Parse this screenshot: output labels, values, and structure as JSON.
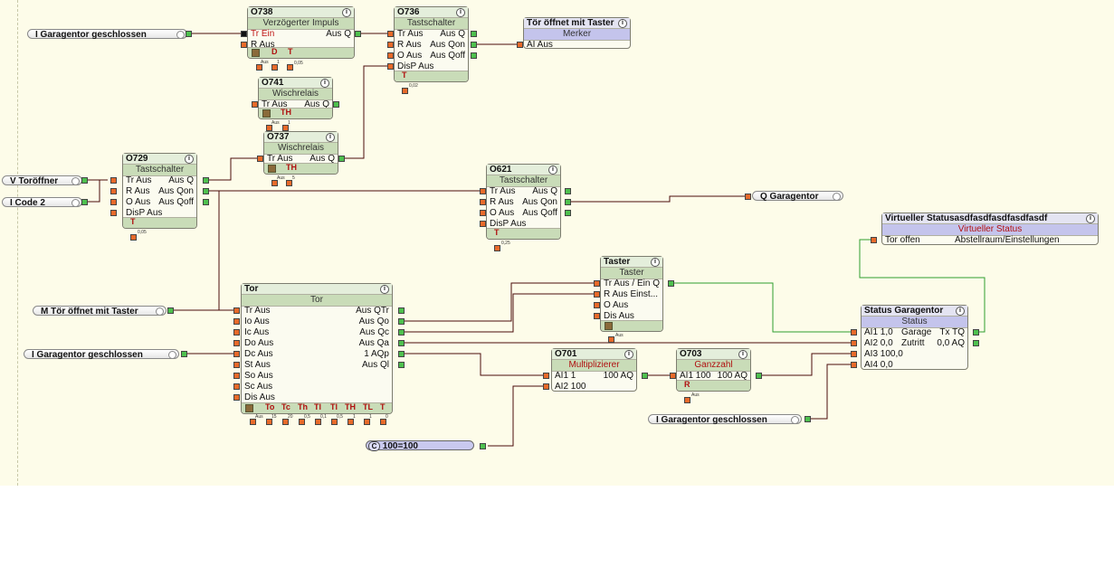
{
  "colors": {
    "wire_dark": "#4a0b0b",
    "wire_green": "#2f9e2f",
    "pin_input": "#e86a2a",
    "pin_output": "#4ec04e",
    "header_green": "#e4eedb",
    "header_purple": "#e4e4f2",
    "canvas_bg": "#fdfce9"
  },
  "inputs": {
    "garagentor1": "I   Garagentor geschlossen",
    "toroeffner": "V   Toröffner",
    "code2": "I   Code 2",
    "toer_taster": "M  Tör öffnet mit Taster",
    "garagentor2": "I   Garagentor geschlossen",
    "garagentor3": "I   Garagentor geschlossen",
    "const": "100=100",
    "const_badge": "C",
    "q_garagentor": "Q   Garagentor"
  },
  "blocks": {
    "o738": {
      "id": "O738",
      "type": "Verzögerter Impuls",
      "in1": "Tr Ein",
      "in2": "R Aus",
      "out1": "Aus Q",
      "p1": "D",
      "p2": "T",
      "t1": "Aus",
      "t2": "1",
      "t3": "0,05"
    },
    "o736": {
      "id": "O736",
      "type": "Tastschalter",
      "in1": "Tr Aus",
      "in2": "R Aus",
      "in3": "O Aus",
      "in4": "DisP Aus",
      "out1": "Aus Q",
      "out2": "Aus Qon",
      "out3": "Aus Qoff",
      "p1": "T",
      "t1": "0,02"
    },
    "merker": {
      "id": "Tör öffnet mit Taster",
      "type": "Merker",
      "in1": "AI Aus"
    },
    "o741": {
      "id": "O741",
      "type": "Wischrelais",
      "in1": "Tr Aus",
      "out1": "Aus Q",
      "p1": "TH",
      "t1": "Aus",
      "t2": "1"
    },
    "o737": {
      "id": "O737",
      "type": "Wischrelais",
      "in1": "Tr Aus",
      "out1": "Aus Q",
      "p1": "TH",
      "t1": "Aus",
      "t2": "5"
    },
    "o729": {
      "id": "O729",
      "type": "Tastschalter",
      "in1": "Tr Aus",
      "in2": "R Aus",
      "in3": "O Aus",
      "in4": "DisP Aus",
      "out1": "Aus Q",
      "out2": "Aus Qon",
      "out3": "Aus Qoff",
      "p1": "T",
      "t1": "0,05"
    },
    "o621": {
      "id": "O621",
      "type": "Tastschalter",
      "in1": "Tr Aus",
      "in2": "R Aus",
      "in3": "O Aus",
      "in4": "DisP Aus",
      "out1": "Aus Q",
      "out2": "Aus Qon",
      "out3": "Aus Qoff",
      "p1": "T",
      "t1": "0,25"
    },
    "virt": {
      "id": "Virtueller Statusasdfasdfasdfasdfasdf",
      "type": "Virtueller Status",
      "in1": "Tor offen",
      "in1v": "Abstellraum/Einstellungen"
    },
    "taster": {
      "id": "Taster",
      "type": "Taster",
      "in1": "Tr Aus",
      "in1b": "/ Ein Q",
      "in2": "R Aus Einst...",
      "in3": "O Aus",
      "in4": "Dis Aus",
      "t1": "Aus"
    },
    "tor": {
      "id": "Tor",
      "type": "Tor",
      "ins": [
        "Tr Aus",
        "Io Aus",
        "Ic Aus",
        "Do Aus",
        "Dc Aus",
        "St Aus",
        "So Aus",
        "Sc Aus",
        "Dis Aus"
      ],
      "outs": [
        "Aus QTr",
        "Aus Qo",
        "Aus Qc",
        "Aus Qa",
        "1 AQp",
        "Aus Ql"
      ],
      "params": [
        "To",
        "Tc",
        "Th",
        "Tl",
        "Tl",
        "TH",
        "TL",
        "T"
      ],
      "tiny": [
        "Aus",
        "15",
        "20",
        "0,5",
        "0,1",
        "0,5",
        "1",
        "1",
        "0"
      ]
    },
    "status": {
      "id": "Status Garagentor",
      "type": "Status",
      "in1": "AI1 1,0",
      "in1b": "Garage",
      "in2": "AI2 0,0",
      "in2b": "Zutritt",
      "in3": "AI3 100,0",
      "in4": "AI4 0,0",
      "out1": "Tx TQ",
      "out2": "0,0 AQ"
    },
    "o701": {
      "id": "O701",
      "type": "Multiplizierer",
      "in1": "AI1 1",
      "in2": "AI2 100",
      "out1": "100 AQ"
    },
    "o703": {
      "id": "O703",
      "type": "Ganzzahl",
      "in1": "AI1 100",
      "out1": "100 AQ",
      "p1": "R",
      "t1": "Aus"
    }
  }
}
